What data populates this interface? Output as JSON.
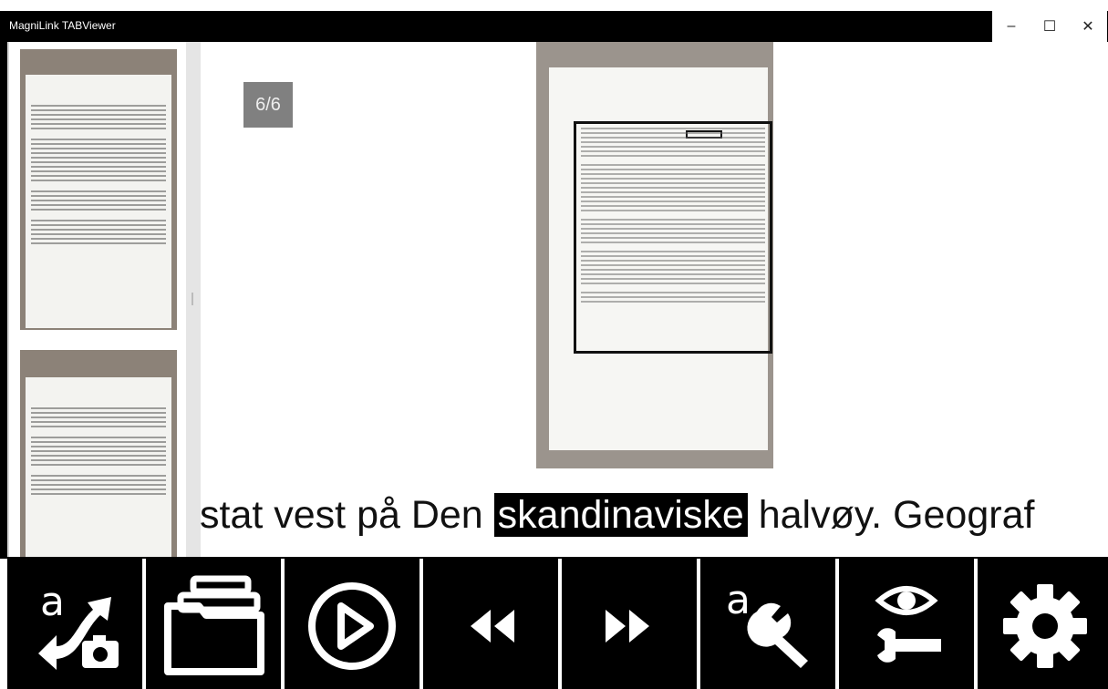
{
  "window": {
    "title": "MagniLink TABViewer",
    "minimize_glyph": "–",
    "maximize_glyph": "☐",
    "close_glyph": "✕"
  },
  "viewer": {
    "page_indicator": "6/6",
    "reading_line": {
      "before": "stat vest på Den ",
      "highlighted": "skandinaviske",
      "after": " halvøy. Geograf"
    }
  },
  "toolbar": {
    "buttons": [
      {
        "name": "ocr-camera-button",
        "icon": "text-camera-swap-icon"
      },
      {
        "name": "open-folder-button",
        "icon": "folder-icon"
      },
      {
        "name": "play-button",
        "icon": "play-circle-icon"
      },
      {
        "name": "rewind-button",
        "icon": "rewind-icon"
      },
      {
        "name": "fast-forward-button",
        "icon": "fast-forward-icon"
      },
      {
        "name": "text-settings-button",
        "icon": "text-wrench-icon"
      },
      {
        "name": "view-settings-button",
        "icon": "eye-wrench-icon"
      },
      {
        "name": "settings-button",
        "icon": "gear-icon"
      }
    ]
  },
  "colors": {
    "toolbar_bg": "#000000",
    "highlight_bg": "#000000",
    "badge_bg": "#808080"
  }
}
